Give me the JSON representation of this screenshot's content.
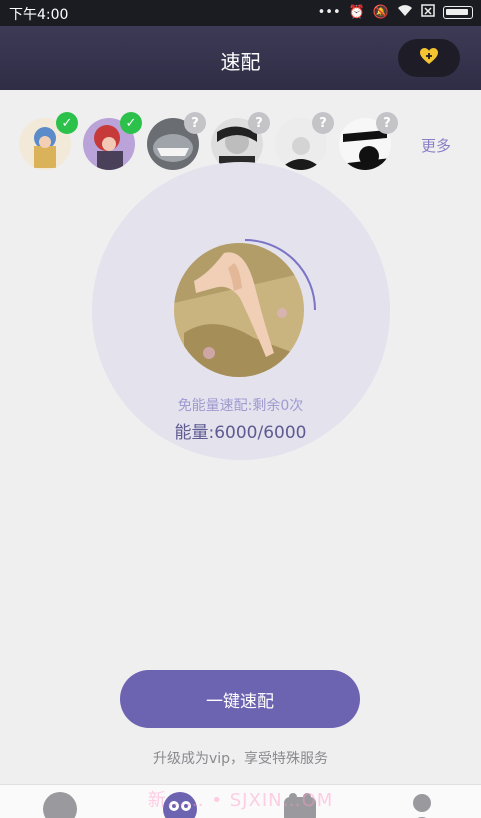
{
  "status_bar": {
    "time": "下午4:00",
    "icons": [
      "dots-icon",
      "alarm-icon",
      "mute-icon",
      "wifi-icon",
      "sim-icon",
      "battery-icon"
    ]
  },
  "header": {
    "title": "速配",
    "gift_icon": "heart-plus-icon"
  },
  "avatars": {
    "items": [
      {
        "name": "avatar-1",
        "status": "matched"
      },
      {
        "name": "avatar-2",
        "status": "matched"
      },
      {
        "name": "avatar-3",
        "status": "unknown"
      },
      {
        "name": "avatar-4",
        "status": "unknown"
      },
      {
        "name": "avatar-5",
        "status": "unknown"
      },
      {
        "name": "avatar-6",
        "status": "unknown"
      }
    ],
    "more_label": "更多"
  },
  "match_panel": {
    "free_text": "免能量速配:剩余0次",
    "energy_text": "能量:6000/6000",
    "progress_fraction": 0.25
  },
  "actions": {
    "match_button": "一键速配",
    "vip_text": "升级成为vip，享受特殊服务"
  },
  "watermark": "新…… • SJXIN…OM",
  "colors": {
    "accent": "#6c63b1",
    "header": "#35334d",
    "matched": "#2cc14a",
    "gift": "#f5c531"
  }
}
